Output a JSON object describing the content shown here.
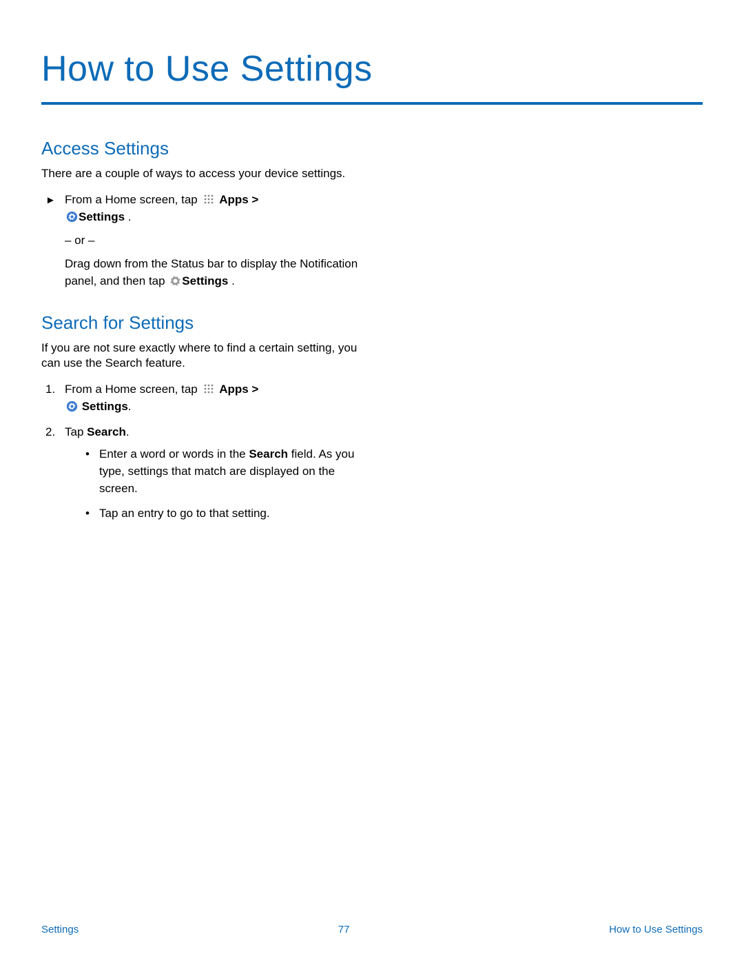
{
  "page_title": "How to Use Settings",
  "section1": {
    "heading": "Access Settings",
    "intro": "There are a couple of ways to access your device settings.",
    "step_prefix": "From a Home screen, tap ",
    "apps_label": "Apps >",
    "settings_label": "Settings",
    "period": " .",
    "or": "– or –",
    "drag_text_a": "Drag down from the Status bar to display the Notification panel, and then tap ",
    "drag_settings": "Settings",
    "drag_text_b": " ."
  },
  "section2": {
    "heading": "Search for Settings",
    "intro": "If you are not sure exactly where to find a certain setting, you can use the Search feature.",
    "step1_prefix": "From a Home screen, tap ",
    "step1_apps": "Apps >",
    "step1_settings": " Settings",
    "step1_period": ".",
    "step2_tap": "Tap ",
    "step2_search": "Search",
    "step2_period": ".",
    "bullet1a": "Enter a word or words in the ",
    "bullet1b": "Search",
    "bullet1c": " field. As you type, settings that match are displayed on the screen.",
    "bullet2": "Tap an entry to go to that setting."
  },
  "footer": {
    "left": "Settings",
    "center": "77",
    "right": "How to Use Settings"
  }
}
